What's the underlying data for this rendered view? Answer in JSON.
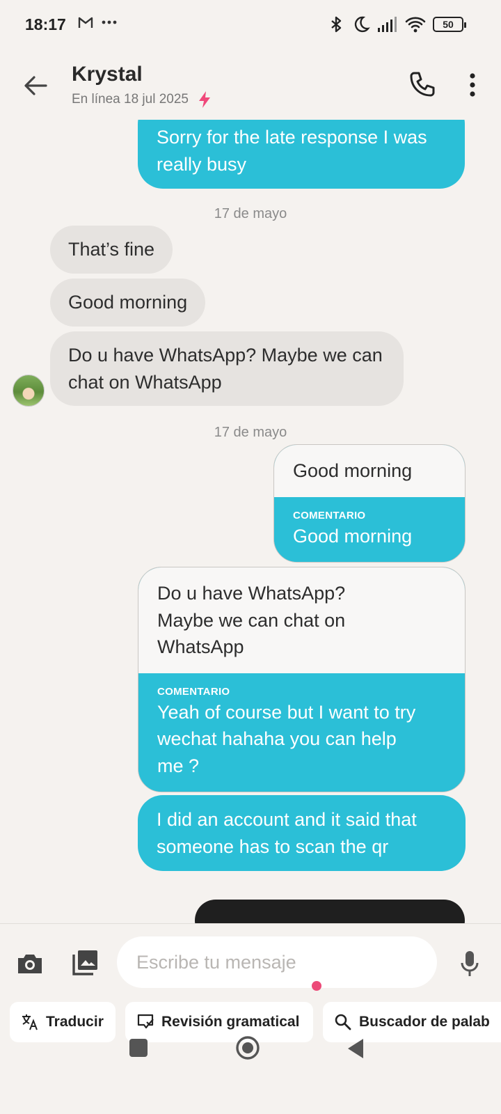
{
  "status_bar": {
    "time": "18:17",
    "notification_icons": [
      "gmail-icon",
      "more-dots-icon"
    ],
    "system_icons": [
      "bluetooth-icon",
      "dnd-moon-icon",
      "signal-icon",
      "wifi-icon",
      "battery-icon"
    ],
    "battery": "50"
  },
  "header": {
    "contact_name": "Krystal",
    "status_text": "En línea 18 jul 2025",
    "boost_color": "#f0487a"
  },
  "messages": {
    "m1": "Sorry for the late response I was really busy",
    "date1": "17 de mayo",
    "m2": "That’s fine",
    "m3": "Good morning",
    "m4": "Do u have WhatsApp? Maybe we can chat on WhatsApp",
    "date2": "17 de mayo",
    "r1_quote": "Good morning",
    "r1_label": "COMENTARIO",
    "r1_comment": "Good morning",
    "r2_quote": "Do u have WhatsApp? Maybe we can chat on WhatsApp",
    "r2_label": "COMENTARIO",
    "r2_comment": "Yeah of course but I want to try wechat hahaha you can help me ?",
    "m5": "I did an account and it said that someone has to scan the qr"
  },
  "composer": {
    "placeholder": "Escribe tu mensaje"
  },
  "tools": {
    "translate": "Traducir",
    "grammar": "Revisión gramatical",
    "search": "Buscador de palab"
  },
  "colors": {
    "outgoing_bubble": "#2bbfd7",
    "incoming_bubble": "#e6e3e0",
    "background": "#f5f2ef",
    "notification_dot": "#ec4a78"
  }
}
